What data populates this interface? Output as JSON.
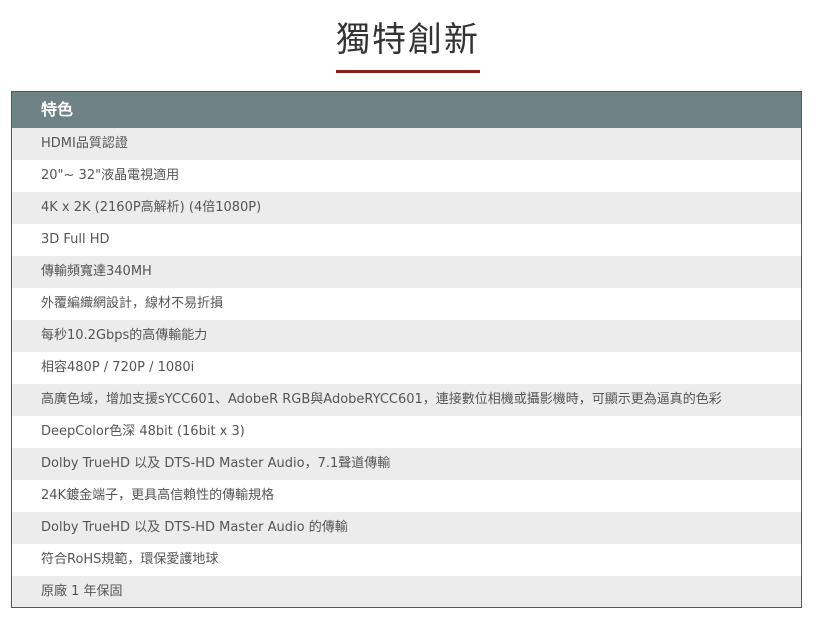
{
  "title": "獨特創新",
  "colors": {
    "accent_underline": "#8e1c1c",
    "header_bg": "#6f8286",
    "row_alt_bg": "#ececec"
  },
  "table": {
    "header": "特色",
    "rows": [
      "HDMI品質認證",
      "20\"~ 32\"液晶電視適用",
      "4K x 2K (2160P高解析) (4倍1080P)",
      "3D Full HD",
      "傳輸頻寬達340MH",
      "外覆編織網設計，線材不易折損",
      "每秒10.2Gbps的高傳輸能力",
      "相容480P / 720P / 1080i",
      "高廣色域，增加支援sYCC601、AdobeR RGB與AdobeRYCC601，連接數位相機或攝影機時，可顯示更為逼真的色彩",
      "DeepColor色深 48bit (16bit x 3)",
      "Dolby TrueHD 以及 DTS-HD Master Audio，7.1聲道傳輸",
      "24K鍍金端子，更具高信賴性的傳輸規格",
      "Dolby TrueHD 以及 DTS-HD Master Audio 的傳輸",
      "符合RoHS規範，環保愛護地球",
      "原廠 1 年保固"
    ]
  }
}
